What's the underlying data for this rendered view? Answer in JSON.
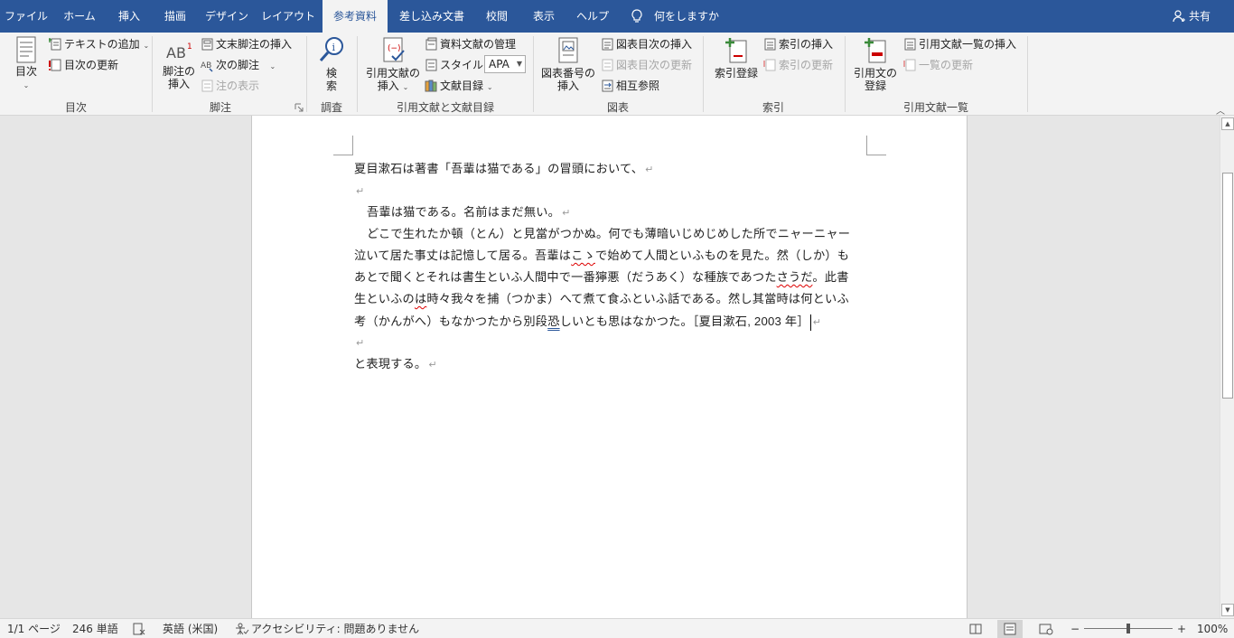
{
  "tabs": [
    {
      "label": "ファイル",
      "active": false
    },
    {
      "label": "ホーム",
      "active": false
    },
    {
      "label": "挿入",
      "active": false
    },
    {
      "label": "描画",
      "active": false
    },
    {
      "label": "デザイン",
      "active": false
    },
    {
      "label": "レイアウト",
      "active": false
    },
    {
      "label": "参考資料",
      "active": true
    },
    {
      "label": "差し込み文書",
      "active": false
    },
    {
      "label": "校閲",
      "active": false
    },
    {
      "label": "表示",
      "active": false
    },
    {
      "label": "ヘルプ",
      "active": false
    }
  ],
  "tell_me": "何をしますか",
  "share": "共有",
  "ribbon": {
    "toc": {
      "group_label": "目次",
      "toc_button": "目次",
      "add_text": "テキストの追加",
      "update_toc": "目次の更新"
    },
    "footnotes": {
      "group_label": "脚注",
      "insert_footnote_line1": "脚注の",
      "insert_footnote_line2": "挿入",
      "insert_endnote": "文末脚注の挿入",
      "next_footnote": "次の脚注",
      "show_notes": "注の表示"
    },
    "research": {
      "group_label": "調査",
      "search_line1": "検",
      "search_line2": "索"
    },
    "citations": {
      "group_label": "引用文献と文献目録",
      "insert_citation_line1": "引用文献の",
      "insert_citation_line2": "挿入",
      "manage_sources": "資料文献の管理",
      "style_label": "スタイル:",
      "style_value": "APA",
      "bibliography": "文献目録"
    },
    "captions": {
      "group_label": "図表",
      "insert_caption_line1": "図表番号の",
      "insert_caption_line2": "挿入",
      "insert_table_of_figures": "図表目次の挿入",
      "update_table": "図表目次の更新",
      "cross_reference": "相互参照"
    },
    "index": {
      "group_label": "索引",
      "mark_entry": "索引登録",
      "insert_index": "索引の挿入",
      "update_index": "索引の更新"
    },
    "authorities": {
      "group_label": "引用文献一覧",
      "mark_citation_line1": "引用文の",
      "mark_citation_line2": "登録",
      "insert_table_of_authorities": "引用文献一覧の挿入",
      "update_table": "一覧の更新"
    }
  },
  "document": {
    "line1": "夏目漱石は著書「吾輩は猫である」の冒頭において、",
    "line3": "吾輩は猫である。名前はまだ無い。",
    "line4": "どこで生れたか頓（とん）と見當がつかぬ。何でも薄暗いじめじめした所でニャーニャー",
    "line5_a": "泣いて居た事丈は記憶して居る。吾輩は",
    "line5_b": "こゝ",
    "line5_c": "で始めて人間といふものを見た。然（しか）も",
    "line6_a": "あとで聞くとそれは書生といふ人間中で一番獰悪（だうあく）な種族であつた",
    "line6_b": "さうだ",
    "line6_c": "。此書",
    "line7_a": "生といふの",
    "line7_b": "は",
    "line7_c": "時々我々を捕（つかま）へて煮て食ふといふ話である。然し其當時は何といふ",
    "line8_a": "考（かんがへ）もなかつたから別段",
    "line8_b": "恐",
    "line8_c": "しいとも思はなかつた。",
    "citation": "［夏目漱石, 2003 年］",
    "line10": "と表現する。",
    "para_mark": "↵"
  },
  "status": {
    "page": "1/1 ページ",
    "words": "246 単語",
    "language": "英語 (米国)",
    "accessibility": "アクセシビリティ: 問題ありません",
    "zoom": "100%",
    "zoom_minus": "−",
    "zoom_plus": "+"
  }
}
